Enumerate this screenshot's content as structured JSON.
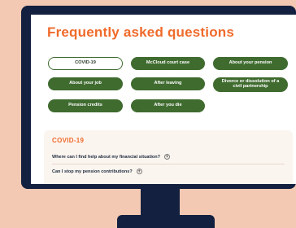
{
  "colors": {
    "background": "#f4c9b3",
    "bezel": "#13203f",
    "screen": "#ffffff",
    "accent": "#f06a2a",
    "button": "#3f6b2f",
    "faq_bg": "#fbf5ef"
  },
  "page": {
    "title": "Frequently asked questions"
  },
  "faq_buttons": [
    {
      "label": "COVID-19",
      "active": true
    },
    {
      "label": "McCloud court case",
      "active": false
    },
    {
      "label": "About your pension",
      "active": false
    },
    {
      "label": "About your job",
      "active": false
    },
    {
      "label": "After leaving",
      "active": false
    },
    {
      "label": "Divorce or dissolution of a civil partnership",
      "active": false
    },
    {
      "label": "Pension credits",
      "active": false
    },
    {
      "label": "After you die",
      "active": false
    }
  ],
  "faq_section": {
    "heading": "COVID-19",
    "questions": [
      {
        "text": "Where can I find help about my financial situation?",
        "icon": "plus-circle-icon"
      },
      {
        "text": "Can I stop my pension contributions?",
        "icon": "plus-circle-icon"
      }
    ]
  }
}
